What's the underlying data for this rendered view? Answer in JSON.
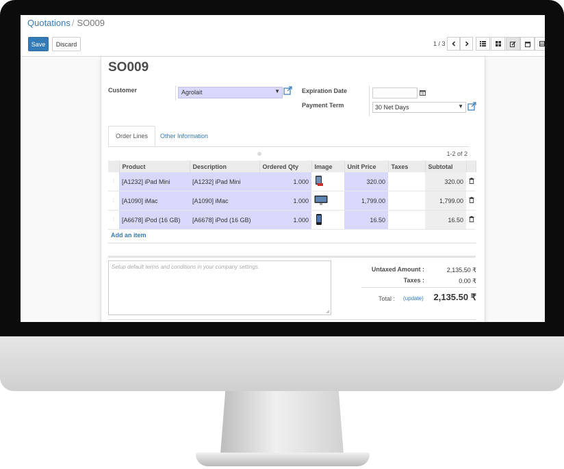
{
  "breadcrumb": {
    "parent": "Quotations",
    "separator": "/",
    "current": "SO009"
  },
  "buttons": {
    "save": "Save",
    "discard": "Discard"
  },
  "pager": {
    "text": "1 / 3",
    "prev_icon": "chevron-left-icon",
    "next_icon": "chevron-right-icon"
  },
  "views": [
    "list-view-icon",
    "kanban-view-icon",
    "form-view-icon",
    "calendar-view-icon",
    "pivot-view-icon"
  ],
  "form": {
    "title": "SO009",
    "customer_label": "Customer",
    "customer_value": "Agrolait",
    "expiration_label": "Expiration Date",
    "expiration_value": "",
    "payment_term_label": "Payment Term",
    "payment_term_value": "30 Net Days"
  },
  "tabs": {
    "order_lines": "Order Lines",
    "other_info": "Other Information"
  },
  "lines": {
    "range": "1-2 of 2",
    "headers": [
      "Product",
      "Description",
      "Ordered Qty",
      "Image",
      "Unit Price",
      "Taxes",
      "Subtotal"
    ],
    "rows": [
      {
        "product": "[A1232] iPad Mini",
        "description": "[A1232] iPad Mini",
        "qty": "1.000",
        "unit_price": "320.00",
        "taxes": "",
        "subtotal": "320.00"
      },
      {
        "product": "[A1090] iMac",
        "description": "[A1090] iMac",
        "qty": "1.000",
        "unit_price": "1,799.00",
        "taxes": "",
        "subtotal": "1,799.00"
      },
      {
        "product": "[A6678] iPod (16 GB)",
        "description": "[A6678] iPod (16 GB)",
        "qty": "1.000",
        "unit_price": "16.50",
        "taxes": "",
        "subtotal": "16.50"
      }
    ],
    "add_item": "Add an item"
  },
  "notes_placeholder": "Setup default terms and conditions in your company settings.",
  "totals": {
    "untaxed_label": "Untaxed Amount :",
    "untaxed_value": "2,135.50 ₹",
    "taxes_label": "Taxes :",
    "taxes_value": "0.00 ₹",
    "total_label": "Total :",
    "update_label": "(update)",
    "total_value": "2,135.50 ₹"
  },
  "colors": {
    "accent": "#337ab7",
    "highlight": "#d8d8fa",
    "bezel": "#0c0c0c"
  }
}
